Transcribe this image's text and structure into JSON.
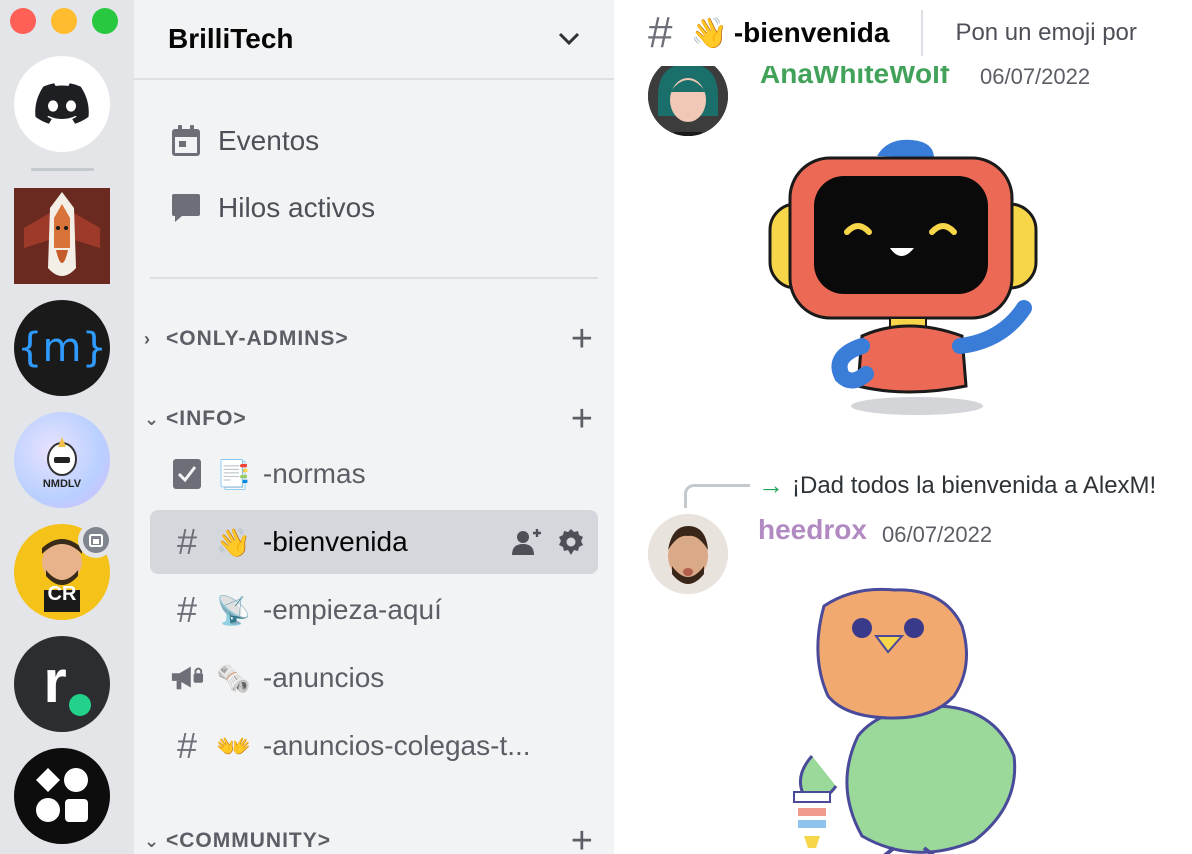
{
  "window": {
    "traffic_lights": [
      "close",
      "minimize",
      "maximize"
    ]
  },
  "servers": [
    {
      "name": "direct-messages-home",
      "icon": "discord-logo-icon"
    },
    {
      "name": "server-1",
      "icon": "fox-avatar"
    },
    {
      "name": "server-2",
      "initials": "{m}"
    },
    {
      "name": "server-3",
      "initials": "NMDLV"
    },
    {
      "name": "server-4",
      "initials": "CR"
    },
    {
      "name": "server-5",
      "initials": "r"
    },
    {
      "name": "server-6",
      "icon": "shapes-icon"
    }
  ],
  "guild": {
    "name": "BrilliTech"
  },
  "nav": {
    "events_label": "Eventos",
    "threads_label": "Hilos activos"
  },
  "categories": {
    "only_admins": "<ONLY-ADMINS>",
    "info": "<INFO>",
    "community": "<COMMUNITY>"
  },
  "channels": [
    {
      "emoji": "📑",
      "label": "-normas",
      "icon": "rules-icon"
    },
    {
      "emoji": "👋",
      "label": "-bienvenida",
      "icon": "hash-icon",
      "active": true
    },
    {
      "emoji": "📡",
      "label": "-empieza-aquí",
      "icon": "hash-icon"
    },
    {
      "emoji": "🗞️",
      "label": "-anuncios",
      "icon": "announcement-icon"
    },
    {
      "emoji": "👐",
      "label": "-anuncios-colegas-t...",
      "icon": "hash-icon"
    }
  ],
  "topbar": {
    "emoji": "👋",
    "channel": "-bienvenida",
    "topic": "Pon un emoji por"
  },
  "messages": [
    {
      "author": "AnaWhiteWolf",
      "date": "06/07/2022",
      "author_color": "#43a25a"
    },
    {
      "reply_text": "¡Dad todos la bienvenida a AlexM!",
      "author": "heedrox",
      "date": "06/07/2022",
      "author_color": "#b18ac1"
    }
  ],
  "colors": {
    "rail_bg": "#e3e5e8",
    "sidebar_bg": "#f2f3f5",
    "active_channel_bg": "#d4d7dc",
    "reply_arrow": "#23a55a"
  }
}
